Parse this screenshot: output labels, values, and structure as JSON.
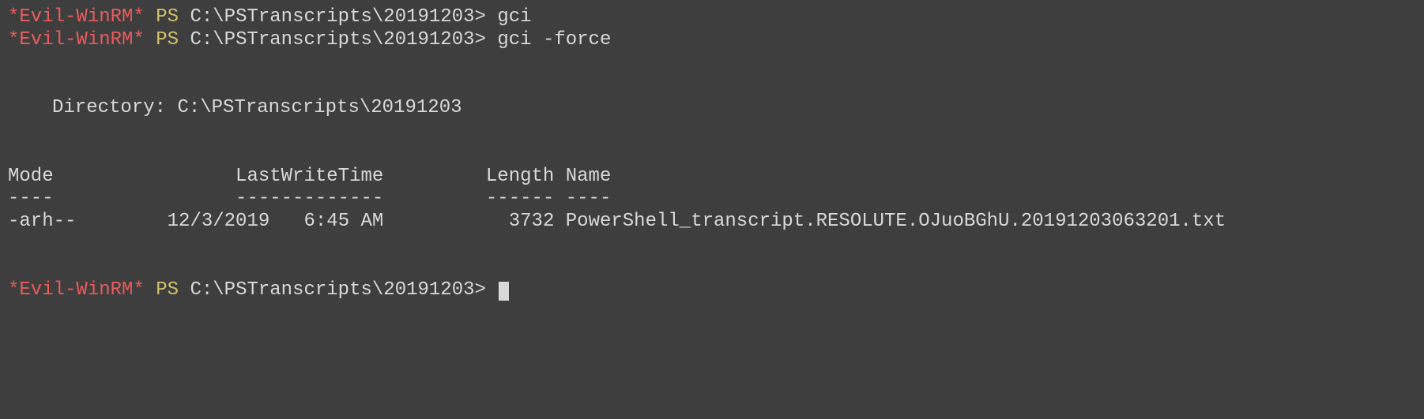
{
  "prompt": {
    "tool": "*Evil-WinRM*",
    "ps": "PS",
    "path": "C:\\PSTranscripts\\20191203>"
  },
  "commands": {
    "cmd1": "gci",
    "cmd2": "gci -force"
  },
  "directory": {
    "label": "Directory:",
    "path": "C:\\PSTranscripts\\20191203"
  },
  "table": {
    "headers": {
      "mode": "Mode",
      "lastwrite": "LastWriteTime",
      "length": "Length",
      "name": "Name"
    },
    "divider": {
      "mode": "----",
      "lastwrite": "-------------",
      "length": "------",
      "name": "----"
    },
    "row": {
      "mode": "-arh--",
      "date": "12/3/2019",
      "time": "6:45 AM",
      "length": "3732",
      "name": "PowerShell_transcript.RESOLUTE.OJuoBGhU.20191203063201.txt"
    }
  }
}
